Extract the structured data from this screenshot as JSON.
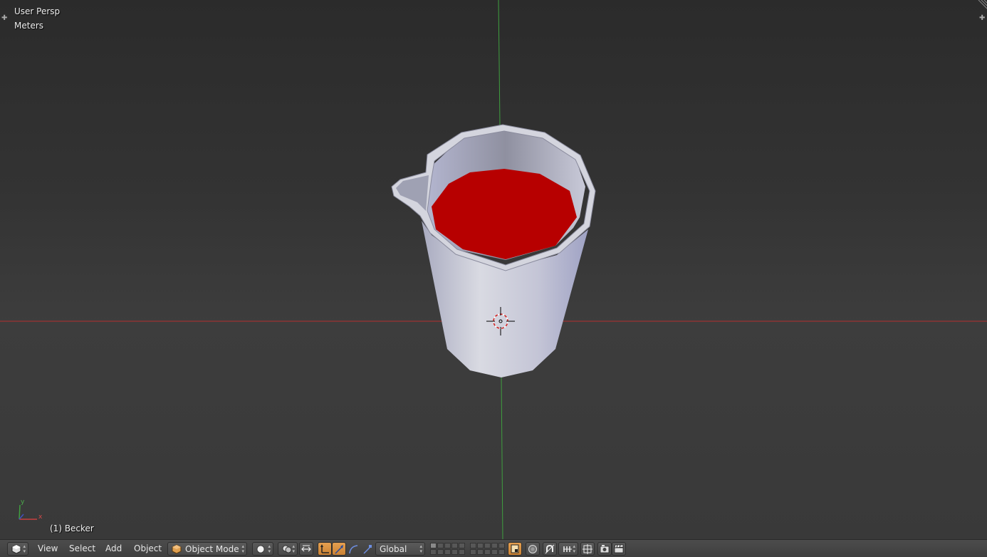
{
  "viewport": {
    "view_name": "User Persp",
    "units": "Meters",
    "object_info": "(1) Becker",
    "axis_labels": {
      "x": "x",
      "y": "y"
    },
    "colors": {
      "x_axis": "#b43030",
      "y_axis": "#3f9f3f",
      "liquid": "#c00000",
      "cup": "#c9cad6"
    }
  },
  "header": {
    "menus": [
      "View",
      "Select",
      "Add",
      "Object"
    ],
    "mode": {
      "label": "Object Mode",
      "icon": "cube-icon"
    },
    "shading": {
      "icon": "solid-sphere-icon"
    },
    "transform_orientation": "Global",
    "icons": [
      "editor-type-icon",
      "pivot-icon",
      "manipulator-toggle-icon",
      "translate-icon",
      "rotate-icon",
      "scale-icon",
      "lock-layers-icon",
      "proportional-edit-icon",
      "snap-icon",
      "snap-element-icon",
      "render-icon",
      "camera-icon",
      "clapper-icon"
    ]
  }
}
